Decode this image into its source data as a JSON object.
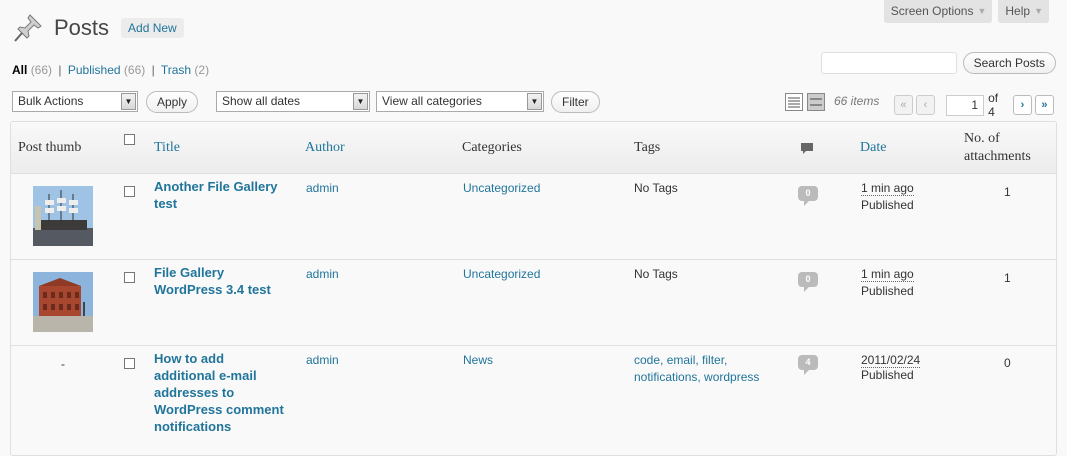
{
  "top_tabs": {
    "screen_options": "Screen Options",
    "help": "Help"
  },
  "header": {
    "title": "Posts",
    "add_new": "Add New"
  },
  "filters": {
    "all": {
      "label": "All",
      "count": "(66)"
    },
    "published": {
      "label": "Published",
      "count": "(66)"
    },
    "trash": {
      "label": "Trash",
      "count": "(2)"
    },
    "separator": "|"
  },
  "search": {
    "value": "",
    "button": "Search Posts"
  },
  "tablenav": {
    "bulk_actions": "Bulk Actions",
    "apply": "Apply",
    "dates": "Show all dates",
    "categories": "View all categories",
    "filter": "Filter",
    "items": "66 items",
    "first": "«",
    "prev": "‹",
    "next": "›",
    "last": "»",
    "current_page": "1",
    "of_pages": "of 4"
  },
  "columns": {
    "thumb": "Post thumb",
    "title": "Title",
    "author": "Author",
    "categories": "Categories",
    "tags": "Tags",
    "date": "Date",
    "attachments_line1": "No. of",
    "attachments_line2": "attachments"
  },
  "rows": [
    {
      "thumb": "ship-photo",
      "title_line1": "Another File Gallery",
      "title_line2": "test",
      "author": "admin",
      "category": "Uncategorized",
      "tags_line1": "No Tags",
      "comments": "0",
      "date": "1 min ago",
      "status": "Published",
      "attachments": "1"
    },
    {
      "thumb": "brick-building-photo",
      "title_line1": "File Gallery",
      "title_line2": "WordPress 3.4 test",
      "author": "admin",
      "category": "Uncategorized",
      "tags_line1": "No Tags",
      "comments": "0",
      "date": "1 min ago",
      "status": "Published",
      "attachments": "1"
    },
    {
      "thumb_text": "-",
      "title_line1": "How to add",
      "title_line2": "additional e-mail",
      "title_line3": "addresses to",
      "title_line4": "WordPress comment",
      "title_line5": "notifications",
      "author": "admin",
      "category": "News",
      "tags_line1": "code, email, filter,",
      "tags_line2": "notifications, wordpress",
      "comments": "4",
      "date": "2011/02/24",
      "status": "Published",
      "attachments": "0"
    }
  ]
}
